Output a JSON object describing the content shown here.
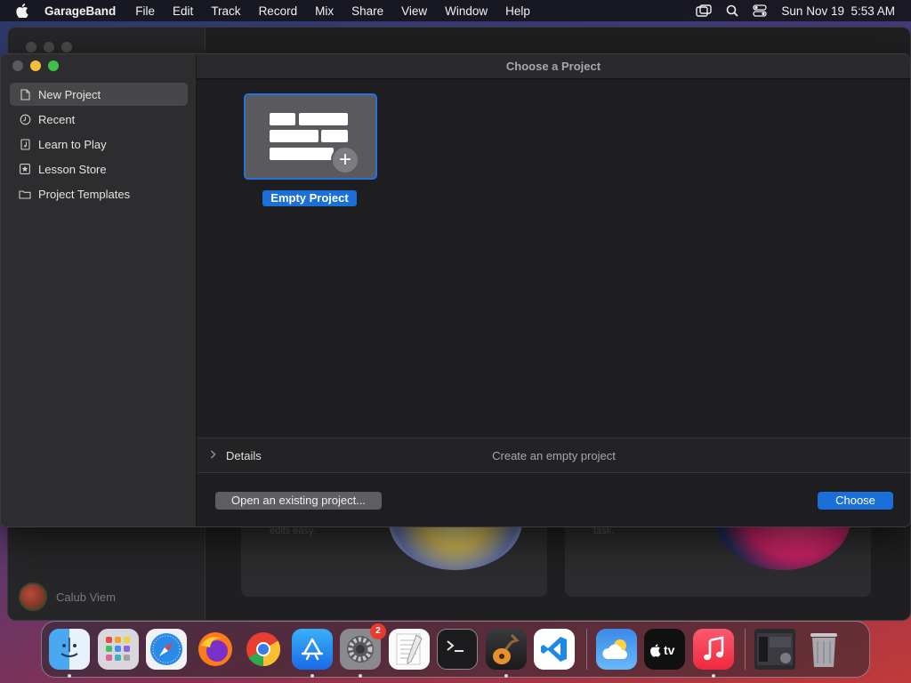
{
  "menubar": {
    "app_name": "GarageBand",
    "menus": [
      "File",
      "Edit",
      "Track",
      "Record",
      "Mix",
      "Share",
      "View",
      "Window",
      "Help"
    ],
    "datetime": "Sun Nov 19  5:53 AM",
    "icons": [
      "apple-icon",
      "window-mirror-icon",
      "search-icon",
      "control-center-icon"
    ]
  },
  "background_window": {
    "user_name": "Calub Viem",
    "card_texts": [
      "edits easy.",
      "task."
    ]
  },
  "dialog": {
    "title": "Choose a Project",
    "sidebar": [
      {
        "label": "New Project",
        "icon": "document-icon",
        "selected": true
      },
      {
        "label": "Recent",
        "icon": "clock-icon",
        "selected": false
      },
      {
        "label": "Learn to Play",
        "icon": "music-book-icon",
        "selected": false
      },
      {
        "label": "Lesson Store",
        "icon": "star-box-icon",
        "selected": false
      },
      {
        "label": "Project Templates",
        "icon": "folder-icon",
        "selected": false
      }
    ],
    "project_tile": {
      "label": "Empty Project"
    },
    "details": {
      "label": "Details",
      "description": "Create an empty project"
    },
    "buttons": {
      "open_existing": "Open an existing project...",
      "choose": "Choose"
    }
  },
  "dock": {
    "apps": [
      {
        "name": "Finder",
        "running": true
      },
      {
        "name": "Launchpad",
        "running": false
      },
      {
        "name": "Safari",
        "running": false
      },
      {
        "name": "Firefox",
        "running": false
      },
      {
        "name": "Chrome",
        "running": false
      },
      {
        "name": "App Store",
        "running": true
      },
      {
        "name": "System Settings",
        "running": true,
        "badge": "2"
      },
      {
        "name": "TextEdit",
        "running": false
      },
      {
        "name": "Terminal",
        "running": false
      },
      {
        "name": "GarageBand",
        "running": true
      },
      {
        "name": "VS Code",
        "running": false
      },
      {
        "name": "Weather",
        "running": false
      },
      {
        "name": "Apple TV",
        "running": false
      },
      {
        "name": "Music",
        "running": true
      },
      {
        "name": "Screenshot Folder",
        "running": false
      },
      {
        "name": "Trash",
        "running": false
      }
    ]
  },
  "colors": {
    "accent": "#1a6fd8",
    "sidebar_bg": "#2d2d2f",
    "content_bg": "#1e1e20",
    "selected_row": "#47474a"
  }
}
